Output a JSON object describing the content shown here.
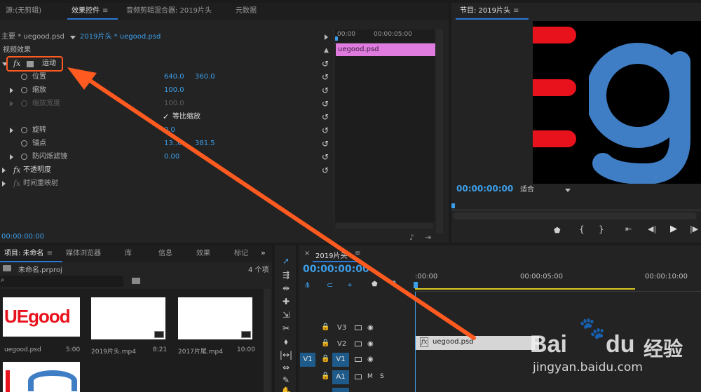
{
  "effect_panel": {
    "tabs": [
      {
        "label": "源:(无剪辑)"
      },
      {
        "label": "效果控件"
      },
      {
        "label": "音频剪辑混合器: 2019片头"
      },
      {
        "label": "元数据"
      }
    ],
    "master_label": "主要 * uegood.psd",
    "clip_label": "2019片头 * uegood.psd",
    "ruler_start": "00:00",
    "ruler_mid": "00:00:05:00",
    "clip_name": "uegood.psd",
    "section_label": "视频效果",
    "motion_label": "运动",
    "properties": [
      {
        "label": "位置",
        "v1": "640.0",
        "v2": "360.0"
      },
      {
        "label": "缩放",
        "v1": "100.0",
        "v2": ""
      },
      {
        "label": "缩放宽度",
        "v1": "100.0",
        "v2": ""
      },
      {
        "label": "等比缩放",
        "v1": "",
        "v2": ""
      },
      {
        "label": "旋转",
        "v1": "0.0",
        "v2": ""
      },
      {
        "label": "锚点",
        "v1": "13..0",
        "v2": "381.5"
      },
      {
        "label": "防闪烁滤镜",
        "v1": "0.00",
        "v2": ""
      }
    ],
    "opacity_label": "不透明度",
    "time_remap_label": "时间重映射",
    "timecode": "00:00:00:00"
  },
  "program_monitor": {
    "title": "节目: 2019片头",
    "timecode": "00:00:00:00",
    "fit_label": "适合"
  },
  "project_panel": {
    "tabs": [
      {
        "label": "项目: 未命名"
      },
      {
        "label": "媒体浏览器"
      },
      {
        "label": "库"
      },
      {
        "label": "信息"
      },
      {
        "label": "效果"
      },
      {
        "label": "标记"
      }
    ],
    "project_file": "未命名.prproj",
    "item_count": "4 个项",
    "items": [
      {
        "name": "uegood.psd",
        "duration": "5:00"
      },
      {
        "name": "2019片头.mp4",
        "duration": "8:21"
      },
      {
        "name": "2017片尾.mp4",
        "duration": "10:00"
      }
    ],
    "thumb_text": "UEgood"
  },
  "timeline": {
    "title": "2019片头",
    "timecode": "00:00:00:00",
    "ruler": [
      ":00:00",
      "00:00:05:00",
      "00:00:10:00"
    ],
    "tracks": [
      {
        "label": "V3"
      },
      {
        "label": "V2"
      },
      {
        "source": "V1",
        "label": "V1"
      },
      {
        "label": "A1",
        "m": "M",
        "s": "S"
      }
    ],
    "clip_name": "uegood.psd"
  },
  "watermark": {
    "brand": "Bai",
    "brand2": "经验",
    "url": "jingyan.baidu.com"
  },
  "colors": {
    "accent": "#2b77d4",
    "timecode_blue": "#3d9ee8",
    "clip_pink": "#e07be0",
    "arrow": "#ff5a1f",
    "logo_blue": "#3f7ec5",
    "logo_red": "#e8121c"
  }
}
